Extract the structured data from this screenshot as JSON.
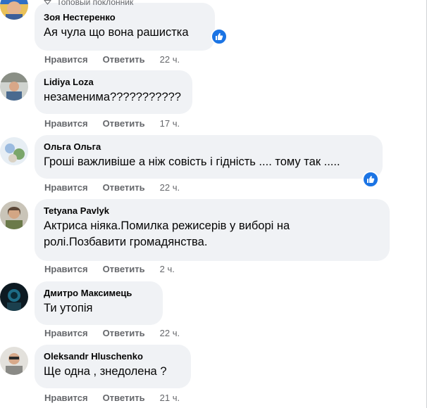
{
  "comments": [
    {
      "badge": "Топовый поклонник",
      "author": "Зоя Нестеренко",
      "text": "Ая чула що вона рашистка",
      "like_label": "Нравится",
      "reply_label": "Ответить",
      "time": "22 ч."
    },
    {
      "author": "Lidiya Loza",
      "text": "незаменима???????????",
      "like_label": "Нравится",
      "reply_label": "Ответить",
      "time": "17 ч."
    },
    {
      "author": "Ольга Ольга",
      "text": "Гроші важливіше а ніж совість і гідність .... тому так .....",
      "like_label": "Нравится",
      "reply_label": "Ответить",
      "time": "22 ч."
    },
    {
      "author": "Tetyana Pavlyk",
      "text_line1": "Актриса ніяка.Помилка режисерів у виборі на",
      "text_line2": "ролі.Позбавити громадянства.",
      "like_label": "Нравится",
      "reply_label": "Ответить",
      "time": "2 ч."
    },
    {
      "author": "Дмитро Максимець",
      "text": "Ти утопія",
      "like_label": "Нравится",
      "reply_label": "Ответить",
      "time": "22 ч."
    },
    {
      "author": "Oleksandr Hluschenko",
      "text": "Ще одна , знедолена ?",
      "like_label": "Нравится",
      "reply_label": "Ответить",
      "time": "21 ч."
    }
  ],
  "colors": {
    "bubble": "#f0f2f5",
    "meta": "#65676b",
    "like_badge": "#1b74e4"
  },
  "icons": [
    "diamond-icon",
    "like-reaction-icon"
  ]
}
